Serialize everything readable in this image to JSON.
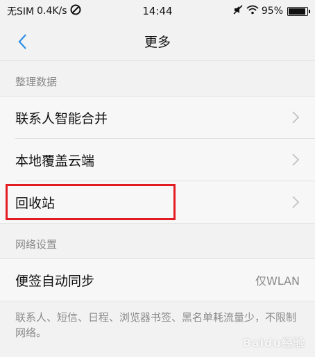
{
  "status_bar": {
    "carrier": "无SIM",
    "speed": "0.4K/s",
    "time": "14:44",
    "battery": "95%",
    "battery_level": 0.95,
    "icons": [
      "no-sim-data-icon",
      "mute-icon",
      "wifi-icon",
      "battery-icon"
    ]
  },
  "header": {
    "title": "更多",
    "back_icon": "chevron-left-icon"
  },
  "sections": [
    {
      "label": "整理数据",
      "items": [
        {
          "label": "联系人智能合并"
        },
        {
          "label": "本地覆盖云端"
        },
        {
          "label": "回收站"
        }
      ]
    },
    {
      "label": "网络设置",
      "items": [
        {
          "label": "便签自动同步",
          "value": "仅WLAN"
        }
      ]
    }
  ],
  "footnote": "联系人、短信、日程、浏览器书签、黑名单耗流量少，不限制网络。",
  "watermark": "Baidu经验",
  "colors": {
    "accent": "#2b8ee8",
    "highlight": "#e31b23"
  }
}
